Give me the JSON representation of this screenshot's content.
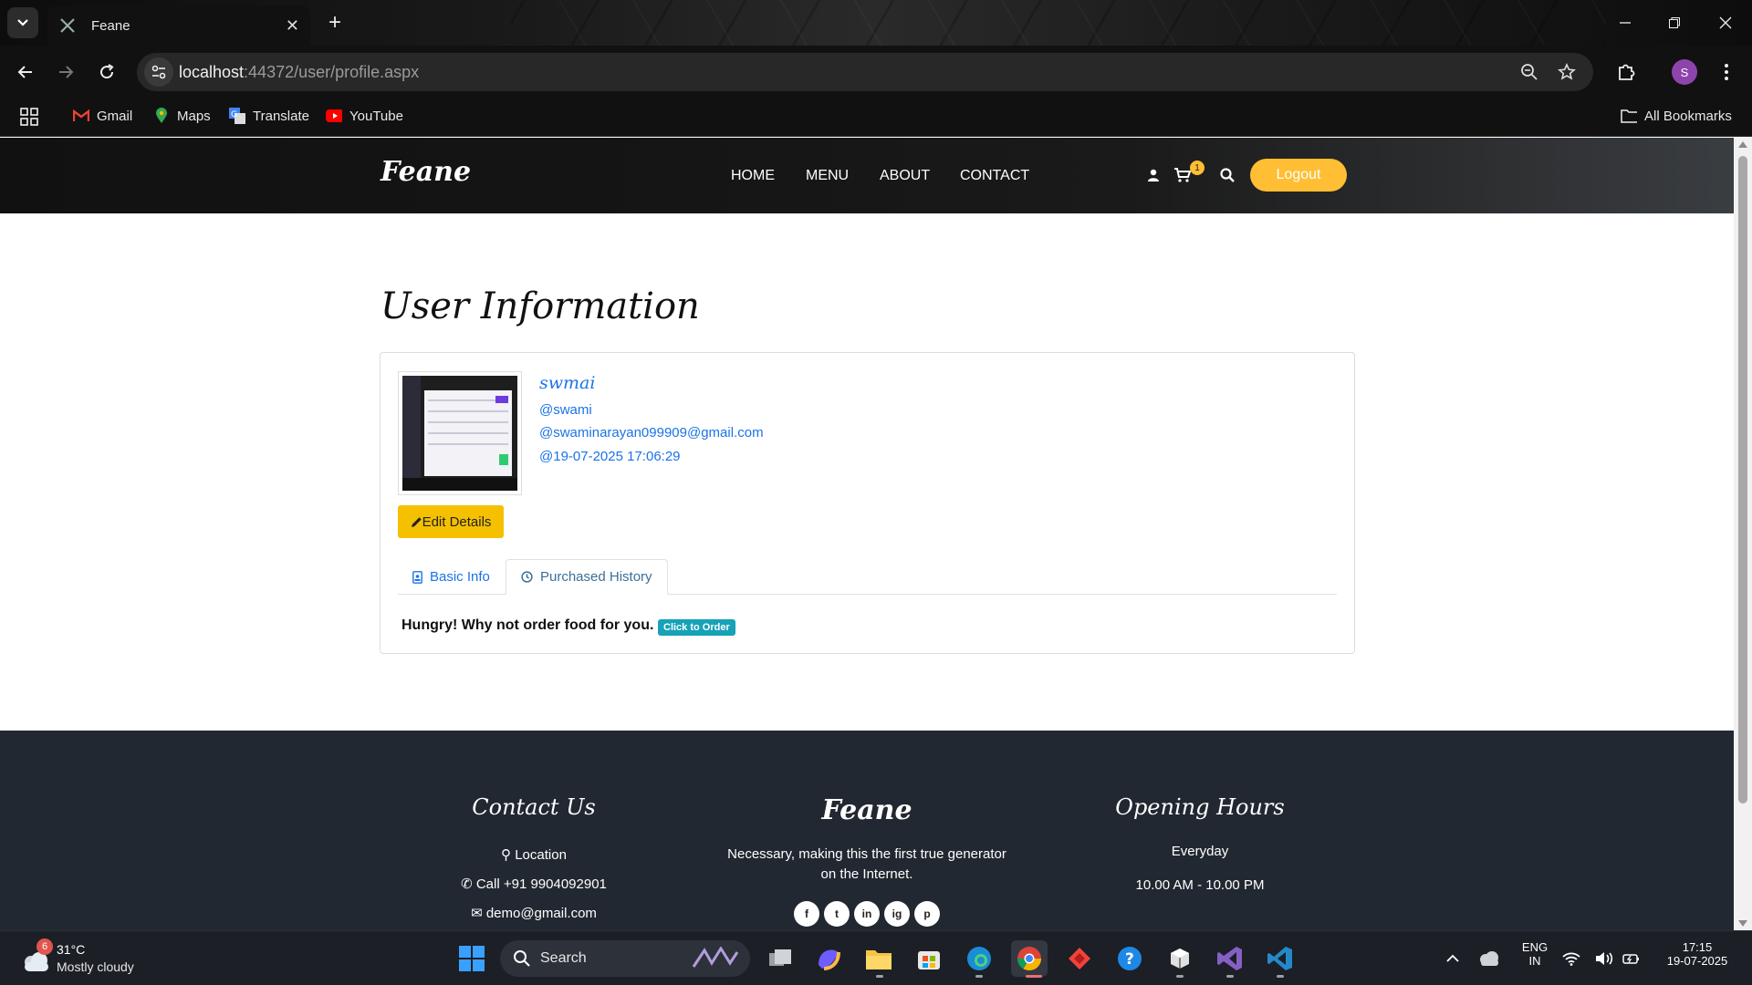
{
  "browser": {
    "tab_title": "Feane",
    "url_host": "localhost",
    "url_rest": ":44372/user/profile.aspx",
    "bookmarks": [
      {
        "label": "Gmail",
        "icon": "gmail-icon"
      },
      {
        "label": "Maps",
        "icon": "maps-icon"
      },
      {
        "label": "Translate",
        "icon": "translate-icon"
      },
      {
        "label": "YouTube",
        "icon": "youtube-icon"
      }
    ],
    "all_bookmarks": "All Bookmarks",
    "profile_initial": "S"
  },
  "site": {
    "brand": "Feane",
    "nav": [
      "HOME",
      "MENU",
      "ABOUT",
      "CONTACT"
    ],
    "cart_count": "1",
    "logout": "Logout",
    "accent": "#ffbe33"
  },
  "profile": {
    "title": "User Information",
    "display_name": "swmai",
    "username": "@swami",
    "email": "@swaminarayan099909@gmail.com",
    "joined": "@19-07-2025 17:06:29",
    "edit_label": "Edit Details",
    "tabs": [
      "Basic Info",
      "Purchased History"
    ],
    "active_tab": "Purchased History",
    "hungry_text": "Hungry! Why not order food for you.",
    "order_label": "Click to Order"
  },
  "footer": {
    "contact_title": "Contact Us",
    "location": "Location",
    "phone": "Call +91 9904092901",
    "email": "demo@gmail.com",
    "brand": "Feane",
    "tagline_1": "Necessary, making this the first true generator",
    "tagline_2": "on the Internet.",
    "social": [
      "f",
      "t",
      "in",
      "ig",
      "p"
    ],
    "hours_title": "Opening Hours",
    "hours_days": "Everyday",
    "hours_time": "10.00 AM - 10.00 PM"
  },
  "taskbar": {
    "temp": "31°C",
    "condition": "Mostly cloudy",
    "weather_badge": "6",
    "search": "Search",
    "lang_1": "ENG",
    "lang_2": "IN",
    "time": "17:15",
    "date": "19-07-2025"
  }
}
